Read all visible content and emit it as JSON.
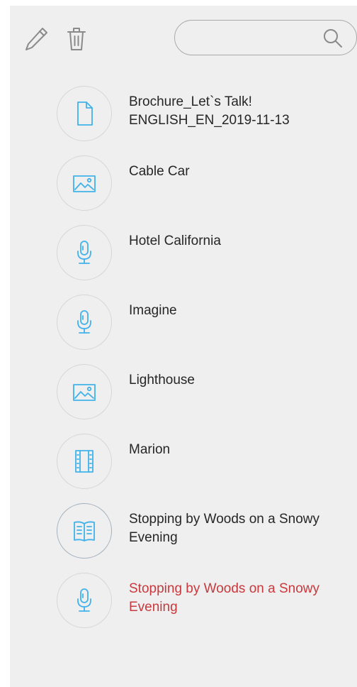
{
  "colors": {
    "accent": "#41b2ea",
    "toolbar_icon": "#8a8a8a",
    "text": "#262626",
    "highlight_text": "#c8393d",
    "panel_bg": "#efefef"
  },
  "toolbar": {
    "edit_icon": "pencil-icon",
    "delete_icon": "trash-icon"
  },
  "search": {
    "value": "",
    "placeholder": "",
    "icon": "search-icon"
  },
  "items": [
    {
      "label": "Brochure_Let`s Talk! ENGLISH_EN_2019-11-13",
      "type": "document",
      "icon": "document-icon"
    },
    {
      "label": "Cable Car",
      "type": "image",
      "icon": "image-icon"
    },
    {
      "label": "Hotel California",
      "type": "audio",
      "icon": "microphone-icon"
    },
    {
      "label": "Imagine",
      "type": "audio",
      "icon": "microphone-icon"
    },
    {
      "label": "Lighthouse",
      "type": "image",
      "icon": "image-icon"
    },
    {
      "label": "Marion",
      "type": "video",
      "icon": "film-icon"
    },
    {
      "label": "Stopping by Woods on a Snowy Evening",
      "type": "book",
      "icon": "book-icon"
    },
    {
      "label": "Stopping by Woods on a Snowy Evening",
      "type": "audio",
      "icon": "microphone-icon",
      "highlighted": true
    }
  ]
}
